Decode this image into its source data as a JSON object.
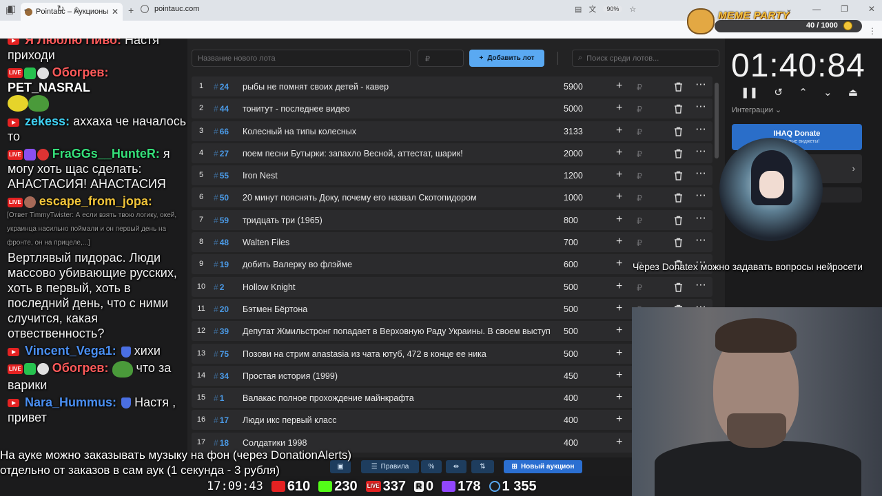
{
  "browser": {
    "tab_title": "Pointauc – Аукционы, лотереи",
    "url": "pointauc.com",
    "zoom": "90%"
  },
  "meme_party": {
    "title": "MEME PARTY",
    "score": "40 / 1000"
  },
  "chat": {
    "messages": [
      {
        "user": "Я Люблю Пиво:",
        "text": "Настя приходи"
      },
      {
        "user": "Обогрев:",
        "text": "PET_NASRAL"
      },
      {
        "user": "zekess:",
        "text": "аххаха че началось то"
      },
      {
        "user": "FraGGs__HunteR:",
        "text": "я могу хоть щас сделать: АНАСТАСИЯ! АНАСТАСИЯ"
      },
      {
        "user": "escape_from_jopa:",
        "reply": "[Ответ TimmyTwister: А если взять твою логику, окей, украинца насильно поймали и он первый день на фронте, он на прицеле,...]",
        "text": "Вертлявый пидорас. Люди массово убивающие русских, хоть в первый, хоть в последний день, что с ними случится, какая отвественность?"
      },
      {
        "user": "Vincent_Vega1:",
        "text": "хихи"
      },
      {
        "user": "Обогрев:",
        "text": "что за варики"
      },
      {
        "user": "Nara_Hummus:",
        "text": "Настя , привет"
      }
    ]
  },
  "toolbar": {
    "lot_name_placeholder": "Название нового лота",
    "price_placeholder": "₽",
    "add_lot_label": "Добавить лот",
    "search_placeholder": "Поиск среди лотов..."
  },
  "lots": [
    {
      "rank": "1",
      "id": "24",
      "title": "рыбы не помнят своих детей - кавер",
      "amount": "5900"
    },
    {
      "rank": "2",
      "id": "44",
      "title": "тонитут - последнее видео",
      "amount": "5000"
    },
    {
      "rank": "3",
      "id": "66",
      "title": "Колесный на типы колесных",
      "amount": "3133"
    },
    {
      "rank": "4",
      "id": "27",
      "title": "поем песни Бутырки: запахло Весной, аттестат, шарик!",
      "amount": "2000"
    },
    {
      "rank": "5",
      "id": "55",
      "title": "Iron Nest",
      "amount": "1200"
    },
    {
      "rank": "6",
      "id": "50",
      "title": "20 минут пояснять Доку, почему его назвал Скотопидором",
      "amount": "1000"
    },
    {
      "rank": "7",
      "id": "59",
      "title": "тридцать три (1965)",
      "amount": "800"
    },
    {
      "rank": "8",
      "id": "48",
      "title": "Walten Files",
      "amount": "700"
    },
    {
      "rank": "9",
      "id": "19",
      "title": "добить Валерку во флэйме",
      "amount": "600"
    },
    {
      "rank": "10",
      "id": "2",
      "title": "Hollow Knight",
      "amount": "500"
    },
    {
      "rank": "11",
      "id": "20",
      "title": "Бэтмен Бёртона",
      "amount": "500"
    },
    {
      "rank": "12",
      "id": "39",
      "title": "Депутат Жмильстронг попадает в Верховную Раду Украины. В своем выступ",
      "amount": "500"
    },
    {
      "rank": "13",
      "id": "75",
      "title": "Позови на стрим anastasia из чата ютуб, 472 в конце ее ника",
      "amount": "500"
    },
    {
      "rank": "14",
      "id": "34",
      "title": "Простая история (1999)",
      "amount": "450"
    },
    {
      "rank": "15",
      "id": "1",
      "title": "Валакас полное прохождение майнкрафта",
      "amount": "400"
    },
    {
      "rank": "16",
      "id": "17",
      "title": "Люди икс первый класс",
      "amount": "400"
    },
    {
      "rank": "17",
      "id": "18",
      "title": "Солдатики 1998",
      "amount": "400"
    }
  ],
  "currency_symbol": "₽",
  "timer": {
    "value": "01:40:84",
    "integrations_label": "Интеграции"
  },
  "donate_card": {
    "title": "IHAQ Donate",
    "subtitle": "...кальные виджеты!"
  },
  "overlay": {
    "note_1": "Через Donatex можно задавать вопросы нейросети",
    "note_2_line1": "На ауке можно заказывать музыку на фон (через DonationAlerts)",
    "note_2_line2": "отдельно от заказов в сам аук (1 секунда - 3 рубля)"
  },
  "bottom_bar": {
    "rules_label": "Правила",
    "percent_label": "%",
    "new_auction_label": "Новый аукцион"
  },
  "stats": {
    "clock": "17:09:43",
    "youtube": "610",
    "kick": "230",
    "live": "337",
    "rutube": "0",
    "twitch": "178",
    "total": "1 355"
  }
}
